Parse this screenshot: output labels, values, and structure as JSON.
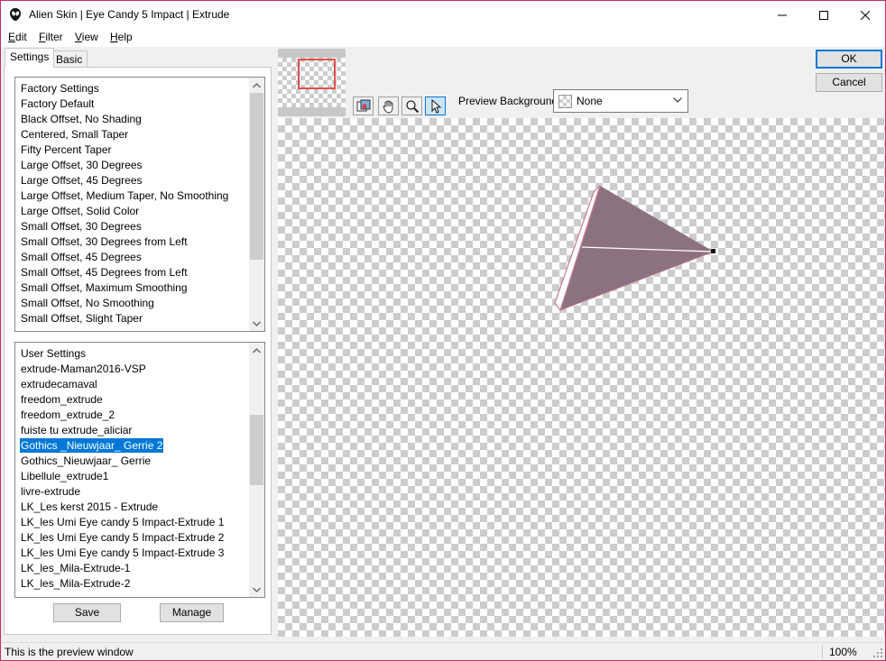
{
  "window": {
    "title": "Alien Skin | Eye Candy 5 Impact | Extrude",
    "accent_color": "#c12f5e"
  },
  "menu": {
    "items": [
      {
        "label": "Edit",
        "mnemonic": "E",
        "rest": "dit"
      },
      {
        "label": "Filter",
        "mnemonic": "F",
        "rest": "ilter"
      },
      {
        "label": "View",
        "mnemonic": "V",
        "rest": "iew"
      },
      {
        "label": "Help",
        "mnemonic": "H",
        "rest": "elp"
      }
    ]
  },
  "tabs": [
    {
      "label": "Settings",
      "active": true
    },
    {
      "label": "Basic",
      "active": false
    }
  ],
  "factory_settings": {
    "header": "Factory Settings",
    "items": [
      "Factory Default",
      "Black Offset, No Shading",
      "Centered, Small Taper",
      "Fifty Percent Taper",
      "Large Offset, 30 Degrees",
      "Large Offset, 45 Degrees",
      "Large Offset, Medium Taper, No Smoothing",
      "Large Offset, Solid Color",
      "Small Offset, 30 Degrees",
      "Small Offset, 30 Degrees from Left",
      "Small Offset, 45 Degrees",
      "Small Offset, 45 Degrees from Left",
      "Small Offset, Maximum Smoothing",
      "Small Offset, No Smoothing",
      "Small Offset, Slight Taper"
    ]
  },
  "user_settings": {
    "header": "User Settings",
    "items": [
      "extrude-Maman2016-VSP",
      "extrudecamaval",
      "freedom_extrude",
      "freedom_extrude_2",
      "fuiste tu extrude_aliciar",
      "Gothics _Nieuwjaar_ Gerrie 2",
      "Gothics_Nieuwjaar_ Gerrie",
      "Libellule_extrude1",
      "livre-extrude",
      "LK_Les kerst 2015 - Extrude",
      "LK_les Umi Eye candy 5 Impact-Extrude 1",
      "LK_les Umi Eye candy 5 Impact-Extrude 2",
      "LK_les Umi Eye candy 5 Impact-Extrude 3",
      "LK_les_Mila-Extrude-1",
      "LK_les_Mila-Extrude-2"
    ],
    "selected": "Gothics _Nieuwjaar_ Gerrie 2"
  },
  "buttons": {
    "save": "Save",
    "manage": "Manage",
    "ok": "OK",
    "cancel": "Cancel"
  },
  "toolbar": {
    "tools": [
      "preview-compare-icon",
      "hand-pan-icon",
      "magnifier-zoom-icon",
      "arrow-select-icon"
    ],
    "active_tool": "arrow-select-icon",
    "preview_background_label": "Preview Background:",
    "preview_background_value": "None"
  },
  "preview": {
    "shape_color": "#8c7280",
    "highlight_color": "#ffffff",
    "edge_color": "#c77a90"
  },
  "status": {
    "message": "This is the preview window",
    "zoom": "100%"
  }
}
